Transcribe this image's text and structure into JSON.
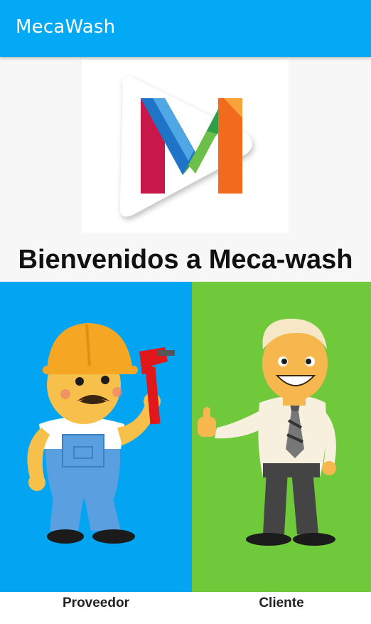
{
  "app": {
    "title": "MecaWash"
  },
  "main": {
    "welcome_text": "Bienvenidos a Meca-wash"
  },
  "options": {
    "provider": {
      "label": "Proveedor",
      "illustration": "plumber-worker-icon"
    },
    "client": {
      "label": "Cliente",
      "illustration": "businessman-thumbs-up-icon"
    }
  },
  "colors": {
    "appbar": "#03a9f4",
    "provider_bg": "#03a5f2",
    "client_bg": "#70c83b"
  }
}
